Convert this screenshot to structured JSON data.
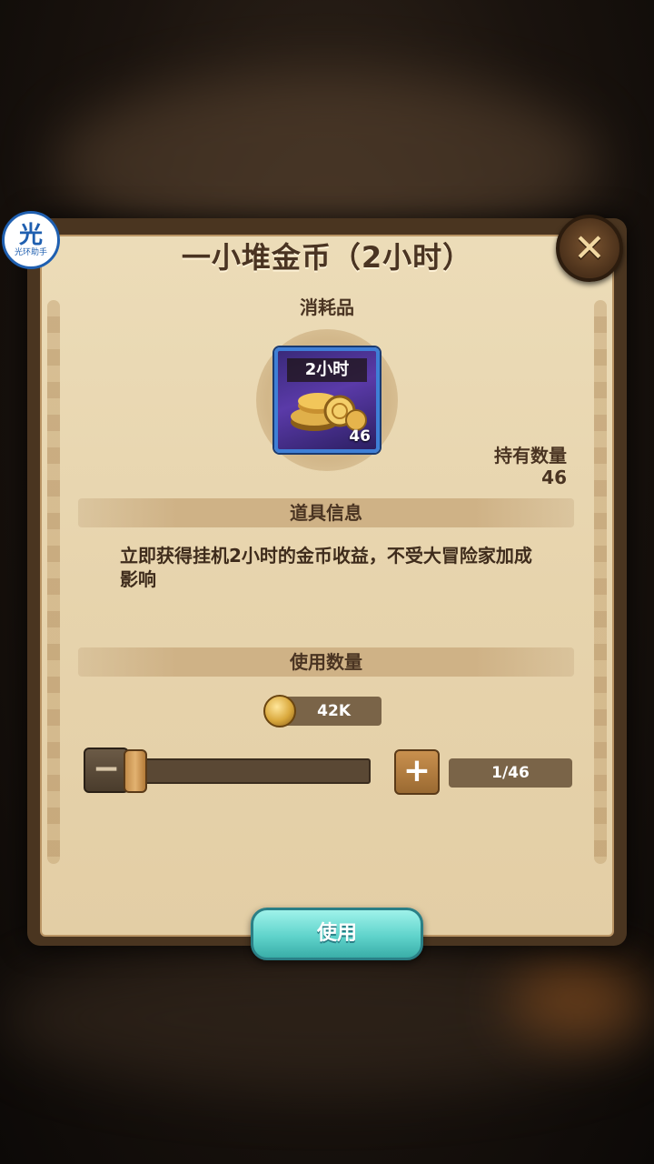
{
  "overlay": {
    "badge_big": "光",
    "badge_small": "光环助手"
  },
  "dialog": {
    "title": "一小堆金币（2小时）",
    "category": "消耗品",
    "close_icon": "close-icon",
    "item": {
      "tag": "2小时",
      "count": "46",
      "icon": "gold-coins-icon"
    },
    "holdings": {
      "label": "持有数量",
      "value": "46"
    },
    "info_section": {
      "title": "道具信息",
      "description": "立即获得挂机2小时的金币收益，不受大冒险家加成影响"
    },
    "usage_section": {
      "title": "使用数量",
      "cost": {
        "icon": "gold-coin-icon",
        "value": "42K"
      },
      "minus_label": "−",
      "plus_label": "+",
      "quantity": "1/46",
      "slider_fraction": 0.0
    },
    "use_button": "使用"
  },
  "colors": {
    "accent_button": "#5fd3cb",
    "panel_bg": "#ecdcb8",
    "text_dark": "#4a3422"
  }
}
